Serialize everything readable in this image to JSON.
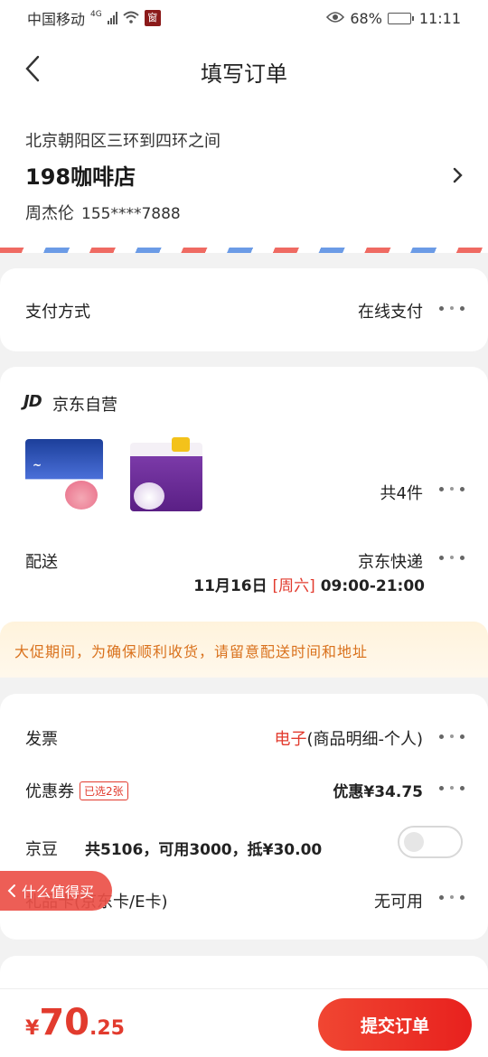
{
  "status_bar": {
    "carrier": "中国移动",
    "network": "4G",
    "badge": "窗",
    "battery_percent": "68%",
    "battery_level": 0.68,
    "time": "11:11"
  },
  "header": {
    "title": "填写订单"
  },
  "address": {
    "line": "北京朝阳区三环到四环之间",
    "shop_name": "198咖啡店",
    "contact_name": "周杰伦",
    "phone": "155****7888"
  },
  "payment": {
    "label": "支付方式",
    "value": "在线支付"
  },
  "store": {
    "logo": "JD",
    "name": "京东自营",
    "product_count": "共4件",
    "delivery_label": "配送",
    "delivery_method": "京东快递",
    "delivery_date": "11月16日",
    "delivery_weekday": "[周六]",
    "delivery_slot": "09:00-21:00"
  },
  "promo": {
    "text": "大促期间，为确保顺利收货，请留意配送时间和地址"
  },
  "invoice": {
    "label": "发票",
    "accent": "电子",
    "detail": "(商品明细-个人)"
  },
  "coupon": {
    "label": "优惠券",
    "tag": "已选2张",
    "value": "优惠¥34.75"
  },
  "jingdou": {
    "label": "京豆",
    "detail": "共5106，可用3000，抵¥30.00",
    "enabled": false
  },
  "gift_card": {
    "label": "礼品卡(京东卡/E卡)",
    "value": "无可用"
  },
  "float_tab": {
    "label": "什么值得买"
  },
  "bottom_bar": {
    "currency": "¥",
    "price_int": "70",
    "price_dec": ".25",
    "submit_label": "提交订单"
  },
  "colors": {
    "accent_red": "#e23b2e",
    "promo_orange": "#d9711c",
    "airmail_red": "#ef6a62",
    "airmail_blue": "#6b9be6"
  }
}
